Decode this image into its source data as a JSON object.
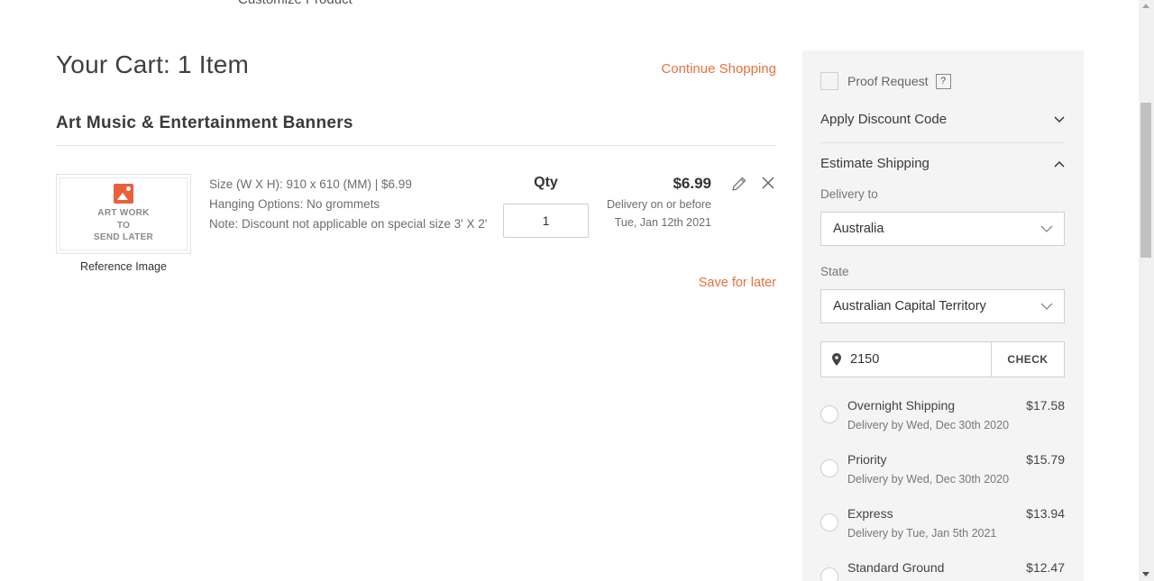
{
  "top_nav": {
    "cut_item": "Customize Product"
  },
  "cart": {
    "title": "Your Cart: 1 Item",
    "continue_label": "Continue Shopping",
    "section_title": "Art Music & Entertainment Banners",
    "item": {
      "thumb_text": "ART WORK\nTO\nSEND LATER",
      "reference_label": "Reference Image",
      "size_line": "Size (W X H): 910 x 610 (MM) | $6.99",
      "hanging_line": "Hanging Options: No grommets",
      "note_line": "Note: Discount not applicable on special size 3' X 2'",
      "qty_label": "Qty",
      "qty_value": "1",
      "price": "$6.99",
      "delivery_line1": "Delivery on or before",
      "delivery_line2": "Tue, Jan 12th 2021"
    },
    "save_later_label": "Save for later"
  },
  "sidebar": {
    "proof_label": "Proof Request",
    "help_label": "?",
    "discount_label": "Apply Discount Code",
    "shipping_label": "Estimate Shipping",
    "delivery_to_label": "Delivery to",
    "country_value": "Australia",
    "state_label": "State",
    "state_value": "Australian Capital Territory",
    "zip_value": "2150",
    "check_label": "CHECK",
    "options": [
      {
        "name": "Overnight Shipping",
        "date": "Delivery by Wed, Dec 30th 2020",
        "price": "$17.58"
      },
      {
        "name": "Priority",
        "date": "Delivery by Wed, Dec 30th 2020",
        "price": "$15.79"
      },
      {
        "name": "Express",
        "date": "Delivery by Tue, Jan 5th 2021",
        "price": "$13.94"
      },
      {
        "name": "Standard Ground",
        "date": "",
        "price": "$12.47"
      }
    ]
  },
  "colors": {
    "accent": "#e8703f",
    "sidebar_bg": "#f4f4f4"
  }
}
